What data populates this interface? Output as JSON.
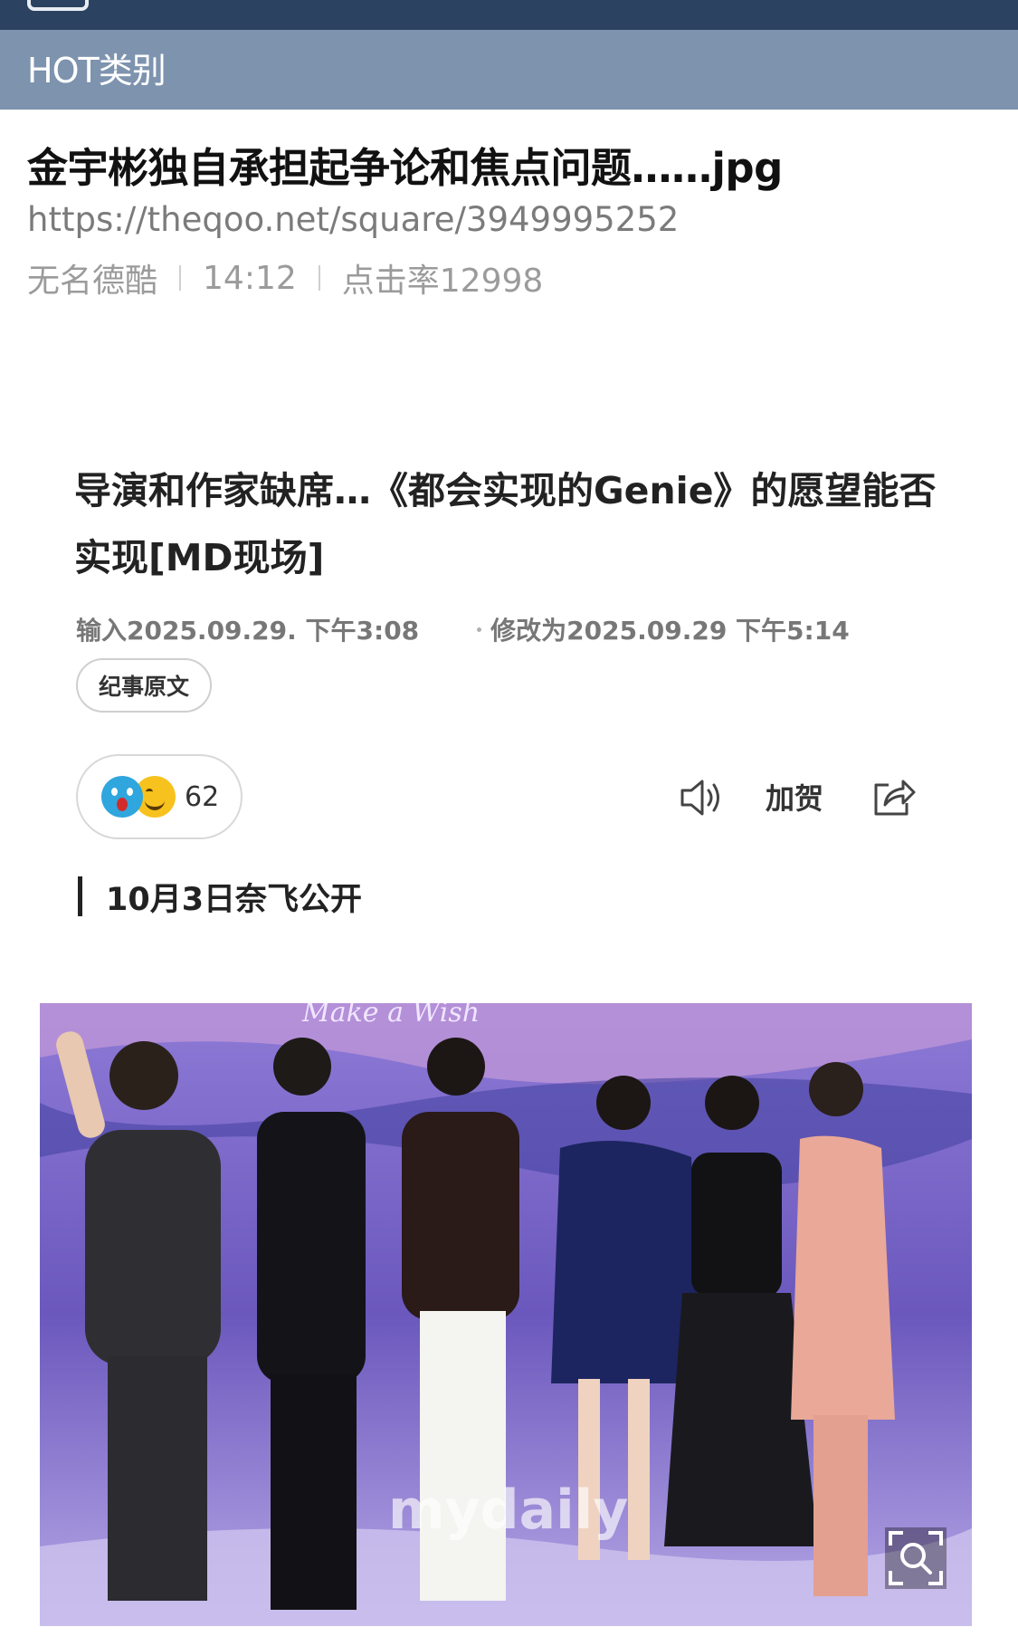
{
  "header": {
    "category_label": "HOT类别"
  },
  "post": {
    "title": "金宇彬独自承担起争论和焦点问题……jpg",
    "url": "https://theqoo.net/square/3949995252",
    "author": "无名德酷",
    "time": "14:12",
    "views": "点击率12998"
  },
  "article": {
    "title_line1": "导演和作家缺席…《都会实现的Genie》的愿望能否",
    "title_line2": "实现[MD现场]",
    "input_date": "输入2025.09.29. 下午3:08",
    "modified_date": "修改为2025.09.29 下午5:14",
    "original_button": "纪事原文",
    "reaction_count": "62",
    "congrats_label": "加贺",
    "subheading": "10月3日奈飞公开"
  },
  "photo": {
    "banner_text": "Make a Wish",
    "watermark": "mydaily"
  },
  "icons": {
    "reaction_1": "shocked-emoji-icon",
    "reaction_2": "grin-emoji-icon",
    "tts": "speaker-icon",
    "share": "share-icon",
    "zoom": "zoom-icon"
  },
  "colors": {
    "top_bar": "#2b4360",
    "category_bar": "#7d93ae",
    "photo_background": "#6a56b8"
  }
}
